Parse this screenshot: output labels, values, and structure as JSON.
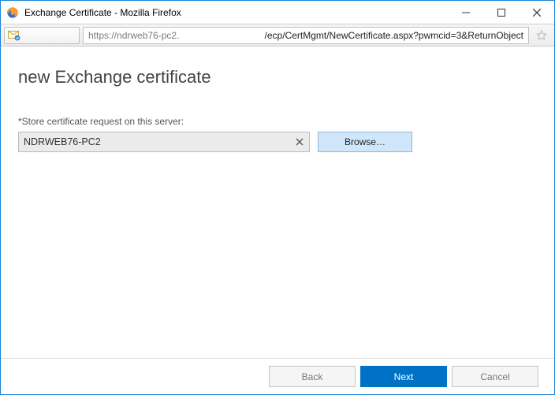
{
  "window": {
    "title": "Exchange Certificate - Mozilla Firefox"
  },
  "address": {
    "prefix": "https://ndrweb76-pc2.",
    "suffix": "/ecp/CertMgmt/NewCertificate.aspx?pwmcid=3&ReturnObject"
  },
  "page": {
    "heading": "new Exchange certificate",
    "field_label": "*Store certificate request on this server:"
  },
  "form": {
    "server_value": "NDRWEB76-PC2",
    "browse_label": "Browse…"
  },
  "footer": {
    "back": "Back",
    "next": "Next",
    "cancel": "Cancel"
  }
}
